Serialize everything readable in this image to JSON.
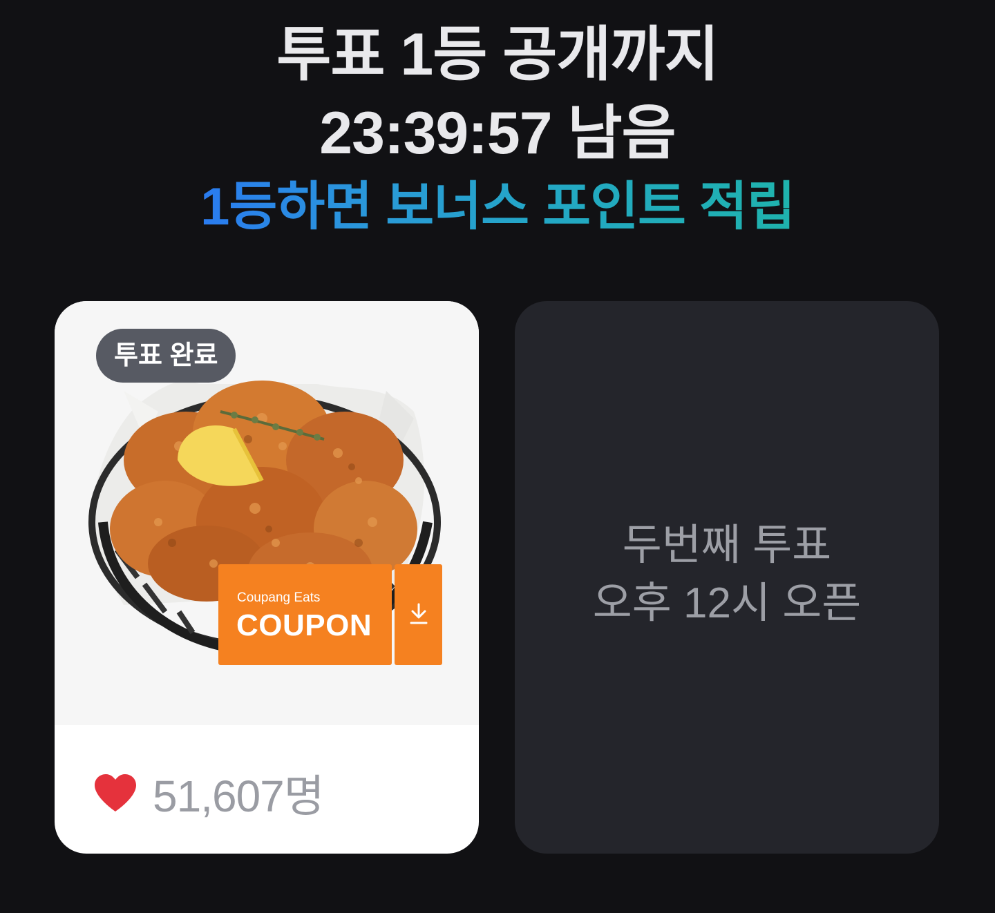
{
  "header": {
    "title_line1": "투표 1등 공개까지",
    "title_line2": "23:39:57 남음",
    "bonus_text": "1등하면 보너스 포인트 적립"
  },
  "card_left": {
    "badge": "투표 완료",
    "coupon_brand": "Coupang Eats",
    "coupon_label": "COUPON",
    "likes": "51,607명",
    "image_alt": "fried chicken in basket with lemon"
  },
  "card_right": {
    "line1": "두번째 투표",
    "line2": "오후 12시 오픈"
  },
  "colors": {
    "background": "#111114",
    "coupon_orange": "#f58120",
    "heart_red": "#e5323c",
    "bonus_gradient_start": "#2a7bf0",
    "bonus_gradient_end": "#1fb3ad"
  }
}
